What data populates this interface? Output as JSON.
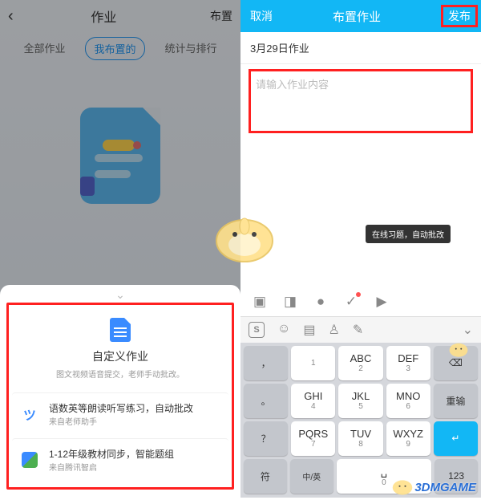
{
  "left": {
    "nav": {
      "title": "作业",
      "right": "布置"
    },
    "tabs": [
      "全部作业",
      "我布置的",
      "统计与排行"
    ],
    "active_tab": 1,
    "sheet": {
      "main": {
        "title": "自定义作业",
        "sub": "图文视频语音提交，老师手动批改。"
      },
      "rows": [
        {
          "title": "语数英等朗读听写练习，自动批改",
          "sub": "来自老师助手"
        },
        {
          "title": "1-12年级教材同步，智能题组",
          "sub": "来自腾讯智启"
        }
      ]
    }
  },
  "right": {
    "nav": {
      "cancel": "取消",
      "title": "布置作业",
      "publish": "发布"
    },
    "date": "3月29日作业",
    "placeholder": "请输入作业内容",
    "tooltip": "在线习题，自动批改"
  },
  "keyboard": {
    "top_keys": [
      ",",
      "1",
      "ABC|2",
      "DEF|3",
      "⌫"
    ],
    "rows": [
      [
        "。",
        "GHI|4",
        "JKL|5",
        "MNO|6",
        "重输"
      ],
      [
        "?",
        "PQRS|7",
        "TUV|8",
        "WXYZ|9",
        ""
      ],
      [
        "符",
        "中/英",
        "␣|0",
        "123",
        ""
      ]
    ],
    "enter": "↵"
  },
  "watermark": "3DMGAME"
}
